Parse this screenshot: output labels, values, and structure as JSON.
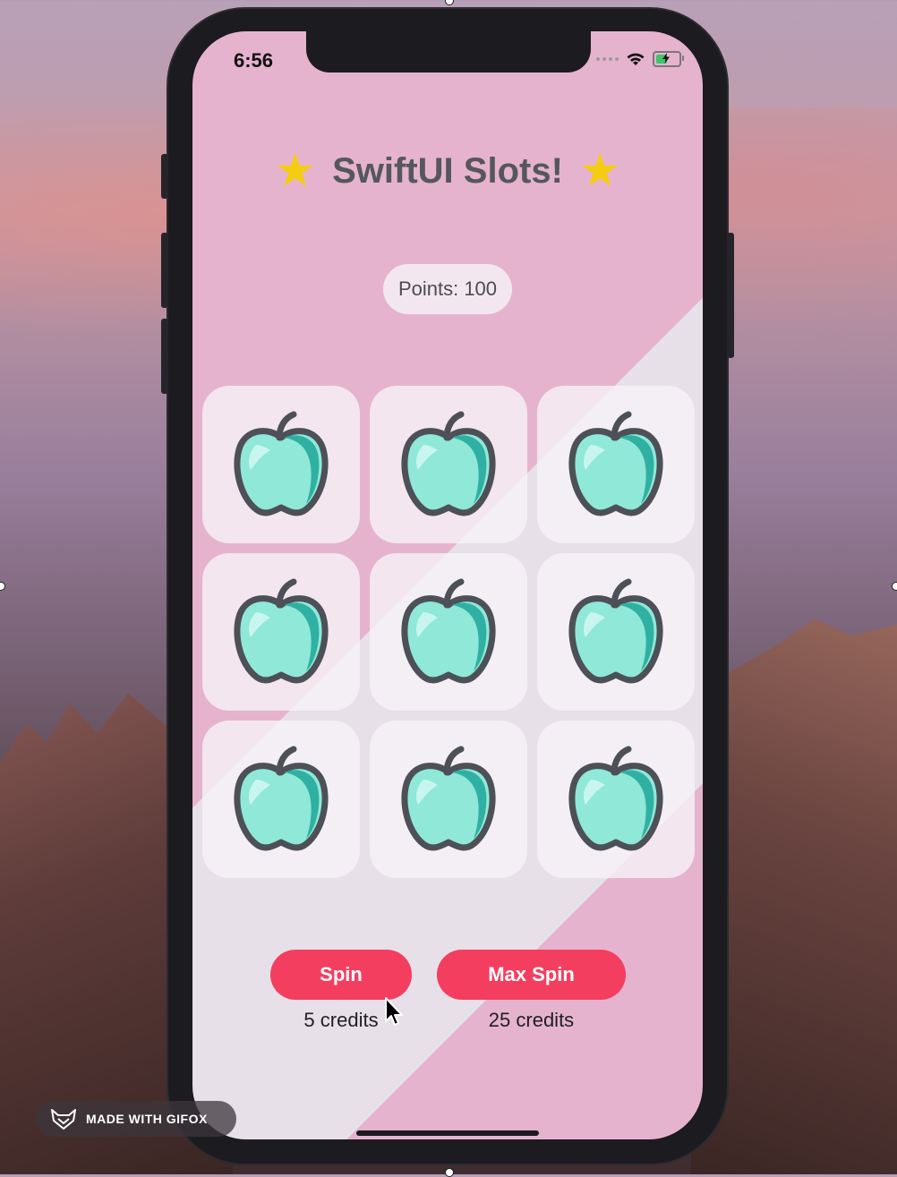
{
  "status_bar": {
    "time": "6:56"
  },
  "app": {
    "title": "SwiftUI Slots!",
    "points_label": "Points: 100",
    "slots": [
      "apple",
      "apple",
      "apple",
      "apple",
      "apple",
      "apple",
      "apple",
      "apple",
      "apple"
    ]
  },
  "actions": {
    "spin_label": "Spin",
    "spin_cost": "5 credits",
    "max_spin_label": "Max Spin",
    "max_spin_cost": "25 credits"
  },
  "badge": {
    "text": "MADE WITH GIFOX"
  },
  "colors": {
    "accent": "#f33e60",
    "star": "#f4cd12",
    "pink_bg": "#e6b3cf",
    "apple": "#8fe8d8"
  },
  "icons": {
    "star": "star-icon",
    "slot": "apple-icon",
    "wifi": "wifi-icon",
    "battery": "battery-charging-icon",
    "cursor": "mouse-pointer-icon",
    "logo": "fox-logo-icon"
  }
}
